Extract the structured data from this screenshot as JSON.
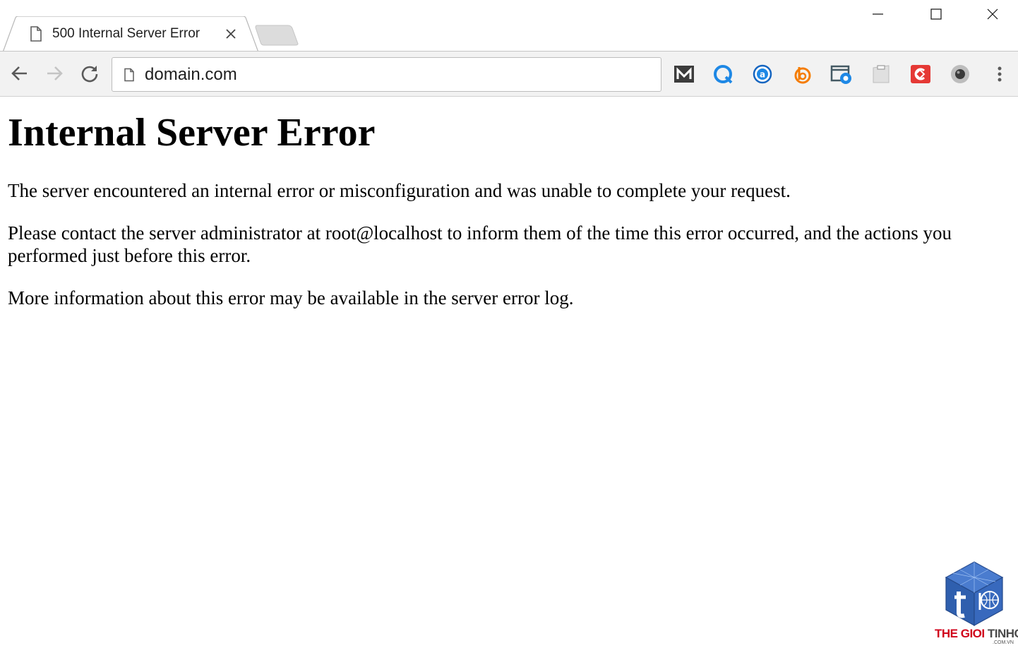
{
  "browser": {
    "tab": {
      "title": "500 Internal Server Error",
      "icon": "page-icon"
    },
    "omnibox": {
      "url": "domain.com",
      "icon": "page-icon"
    },
    "extensions": [
      "m-extension-icon",
      "q-extension-icon",
      "a-extension-icon",
      "b-extension-icon",
      "camera-extension-icon",
      "clipboard-extension-icon",
      "c-extension-icon",
      "record-extension-icon"
    ],
    "colors": {
      "toolbar": "#f2f2f2",
      "accent_blue": "#1a73e8",
      "red": "#e53935",
      "orange": "#f57c00"
    }
  },
  "page": {
    "heading": "Internal Server Error",
    "paragraphs": [
      "The server encountered an internal error or misconfiguration and was unable to complete your request.",
      "Please contact the server administrator at root@localhost to inform them of the time this error occurred, and the actions you performed just before this error.",
      "More information about this error may be available in the server error log."
    ]
  },
  "watermark": {
    "brand": "THE GIOI TINHOC",
    "brand_part1": "THE GIOI ",
    "brand_part2": "TINHOC",
    "sub": ".COM.VN"
  }
}
